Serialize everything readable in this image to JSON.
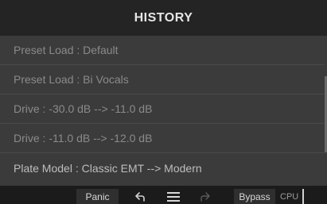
{
  "history": {
    "title": "HISTORY",
    "items": [
      {
        "label": "Preset Load : Default"
      },
      {
        "label": "Preset Load : Bi Vocals"
      },
      {
        "label": "Drive : -30.0 dB --> -11.0 dB"
      },
      {
        "label": "Drive : -11.0 dB --> -12.0 dB"
      },
      {
        "label": "Plate Model : Classic EMT --> Modern"
      }
    ],
    "active_index": 4
  },
  "toolbar": {
    "panic_label": "Panic",
    "bypass_label": "Bypass",
    "cpu_label": "CPU",
    "undo_icon": "undo-arrow-icon",
    "menu_icon": "hamburger-menu-icon",
    "redo_icon": "redo-arrow-icon"
  },
  "colors": {
    "panel_bg": "#3b3b3b",
    "header_bg": "#242424",
    "row_text": "#8a8a8a",
    "active_row_text": "#bdbdbd",
    "toolbar_bg": "#1b1b1b"
  }
}
